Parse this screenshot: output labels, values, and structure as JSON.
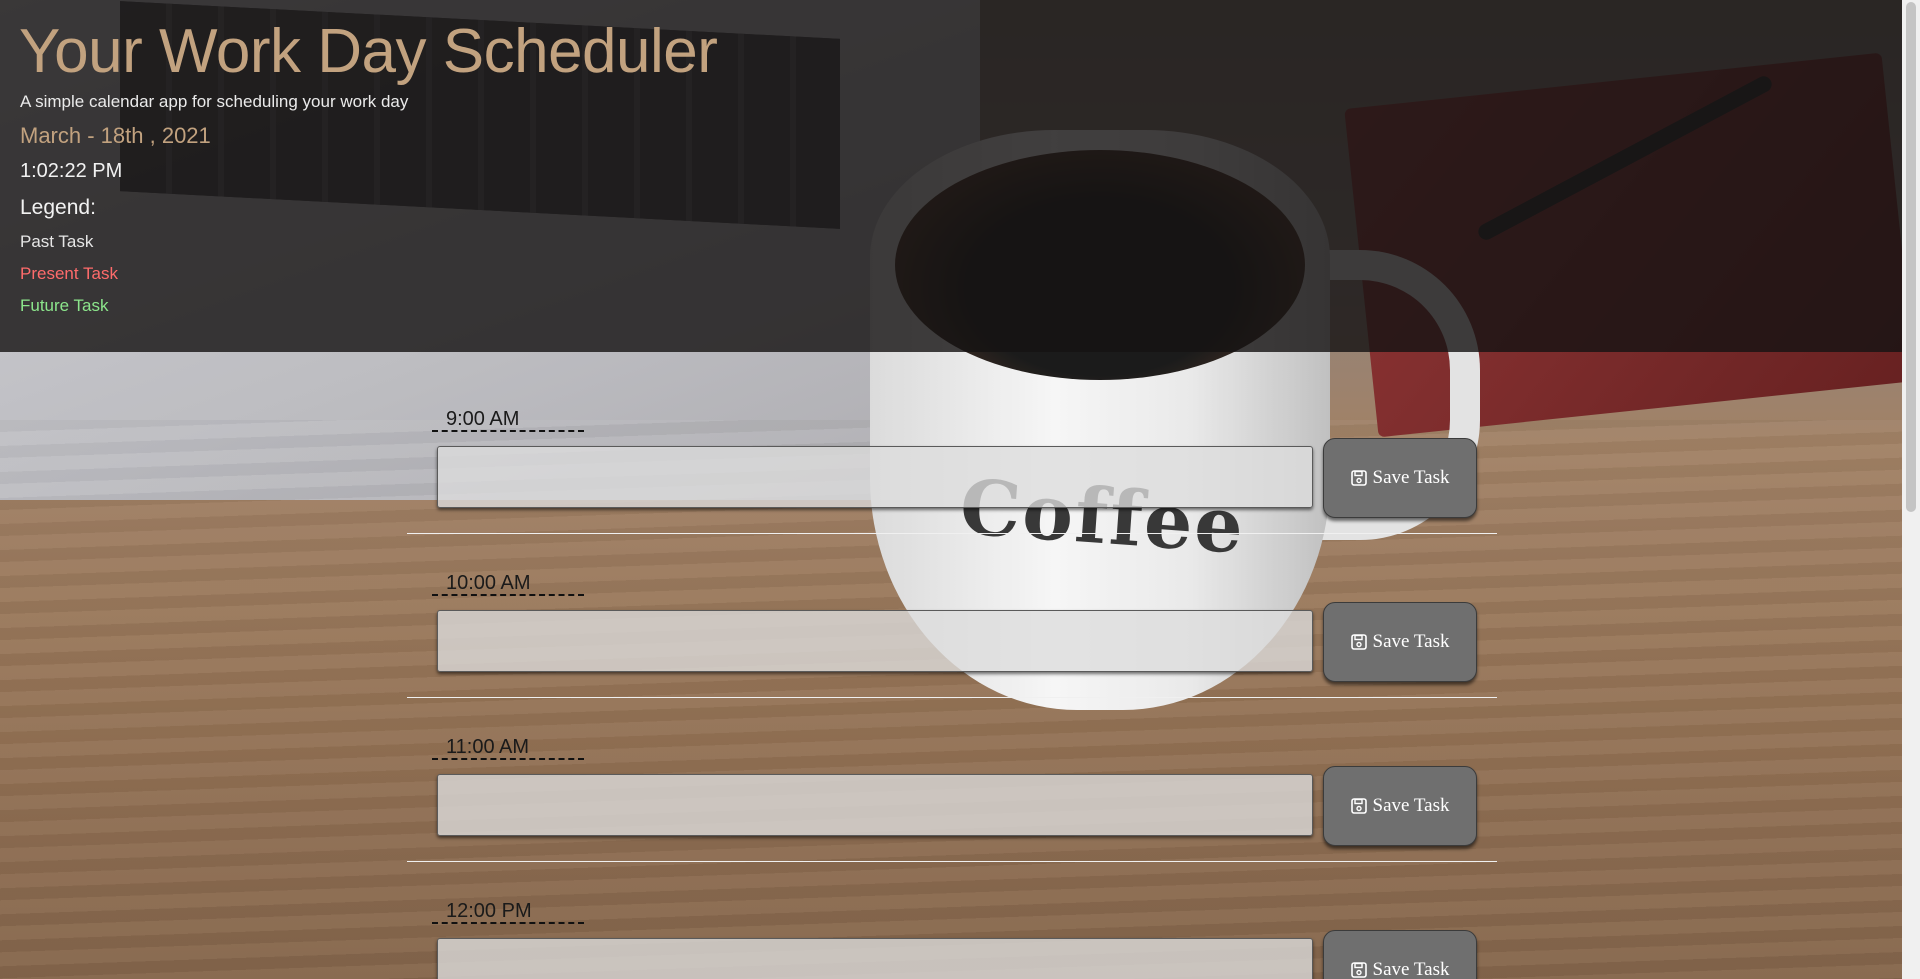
{
  "header": {
    "title": "Your Work Day Scheduler",
    "subtitle": "A simple calendar app for scheduling your work day",
    "date": "March - 18th , 2021",
    "time": "1:02:22 PM",
    "legend_title": "Legend:",
    "legend": {
      "past": "Past Task",
      "present": "Present Task",
      "future": "Future Task"
    }
  },
  "background_decor": {
    "mug_text": "Coffee"
  },
  "hours": [
    {
      "label": "9:00 AM",
      "task": "",
      "save_label": "Save Task"
    },
    {
      "label": "10:00 AM",
      "task": "",
      "save_label": "Save Task"
    },
    {
      "label": "11:00 AM",
      "task": "",
      "save_label": "Save Task"
    },
    {
      "label": "12:00 PM",
      "task": "",
      "save_label": "Save Task"
    }
  ],
  "colors": {
    "accent": "#c2a27f",
    "present": "#ff6b6b",
    "future": "#8ce68c",
    "button": "#6f6f6f"
  },
  "icons": {
    "save": "floppy-disk-icon"
  }
}
